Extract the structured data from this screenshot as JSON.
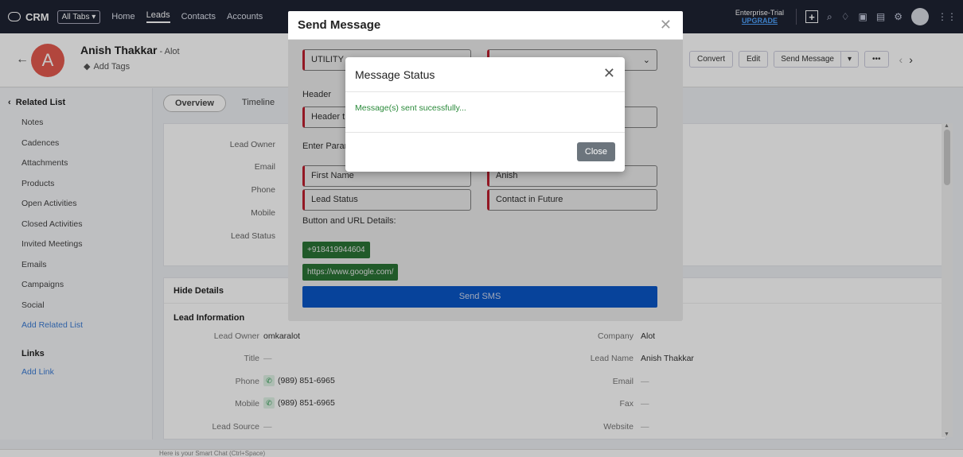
{
  "topbar": {
    "brand": "CRM",
    "all_tabs": "All Tabs ▾",
    "tabs": [
      "Home",
      "Leads",
      "Contacts",
      "Accounts"
    ],
    "trial_line1": "Enterprise-Trial",
    "trial_line2": "UPGRADE"
  },
  "header": {
    "avatar_letter": "A",
    "lead_name": "Anish Thakkar",
    "company_suffix": " - Alot",
    "add_tags": "Add Tags",
    "buttons": {
      "convert": "Convert",
      "edit": "Edit",
      "send_message": "Send Message",
      "more": "•••"
    }
  },
  "sidebar": {
    "title": "Related List",
    "items": [
      "Notes",
      "Cadences",
      "Attachments",
      "Products",
      "Open Activities",
      "Closed Activities",
      "Invited Meetings",
      "Emails",
      "Campaigns",
      "Social",
      "Add Related List"
    ],
    "links_title": "Links",
    "add_link": "Add Link"
  },
  "main": {
    "tabs": [
      "Overview",
      "Timeline"
    ],
    "summary_labels": [
      "Lead Owner",
      "Email",
      "Phone",
      "Mobile",
      "Lead Status"
    ],
    "hide_details": "Hide Details",
    "lead_info_title": "Lead Information",
    "left_fields": [
      {
        "label": "Lead Owner",
        "value": "omkaralot"
      },
      {
        "label": "Title",
        "value": "—"
      },
      {
        "label": "Phone",
        "value": "(989) 851-6965"
      },
      {
        "label": "Mobile",
        "value": "(989) 851-6965"
      },
      {
        "label": "Lead Source",
        "value": "—"
      }
    ],
    "right_fields": [
      {
        "label": "Company",
        "value": "Alot"
      },
      {
        "label": "Lead Name",
        "value": "Anish Thakkar"
      },
      {
        "label": "Email",
        "value": "—"
      },
      {
        "label": "Fax",
        "value": "—"
      },
      {
        "label": "Website",
        "value": "—"
      }
    ]
  },
  "send_modal": {
    "title": "Send Message",
    "category_value": "UTILITY",
    "header_label": "Header",
    "header_value": "Header t",
    "params_label": "Enter Parar",
    "params": [
      {
        "name": "First Name",
        "value": "Anish"
      },
      {
        "name": "Lead Status",
        "value": "Contact in Future"
      }
    ],
    "button_url_label": "Button and URL Details:",
    "phone_button": "+918419944604",
    "url_button": "https://www.google.com/",
    "send_sms": "Send SMS"
  },
  "status_modal": {
    "title": "Message Status",
    "message": "Message(s) sent sucessfully...",
    "close": "Close"
  },
  "bottom": {
    "smart_chat": "Here is your Smart Chat (Ctrl+Space)"
  }
}
